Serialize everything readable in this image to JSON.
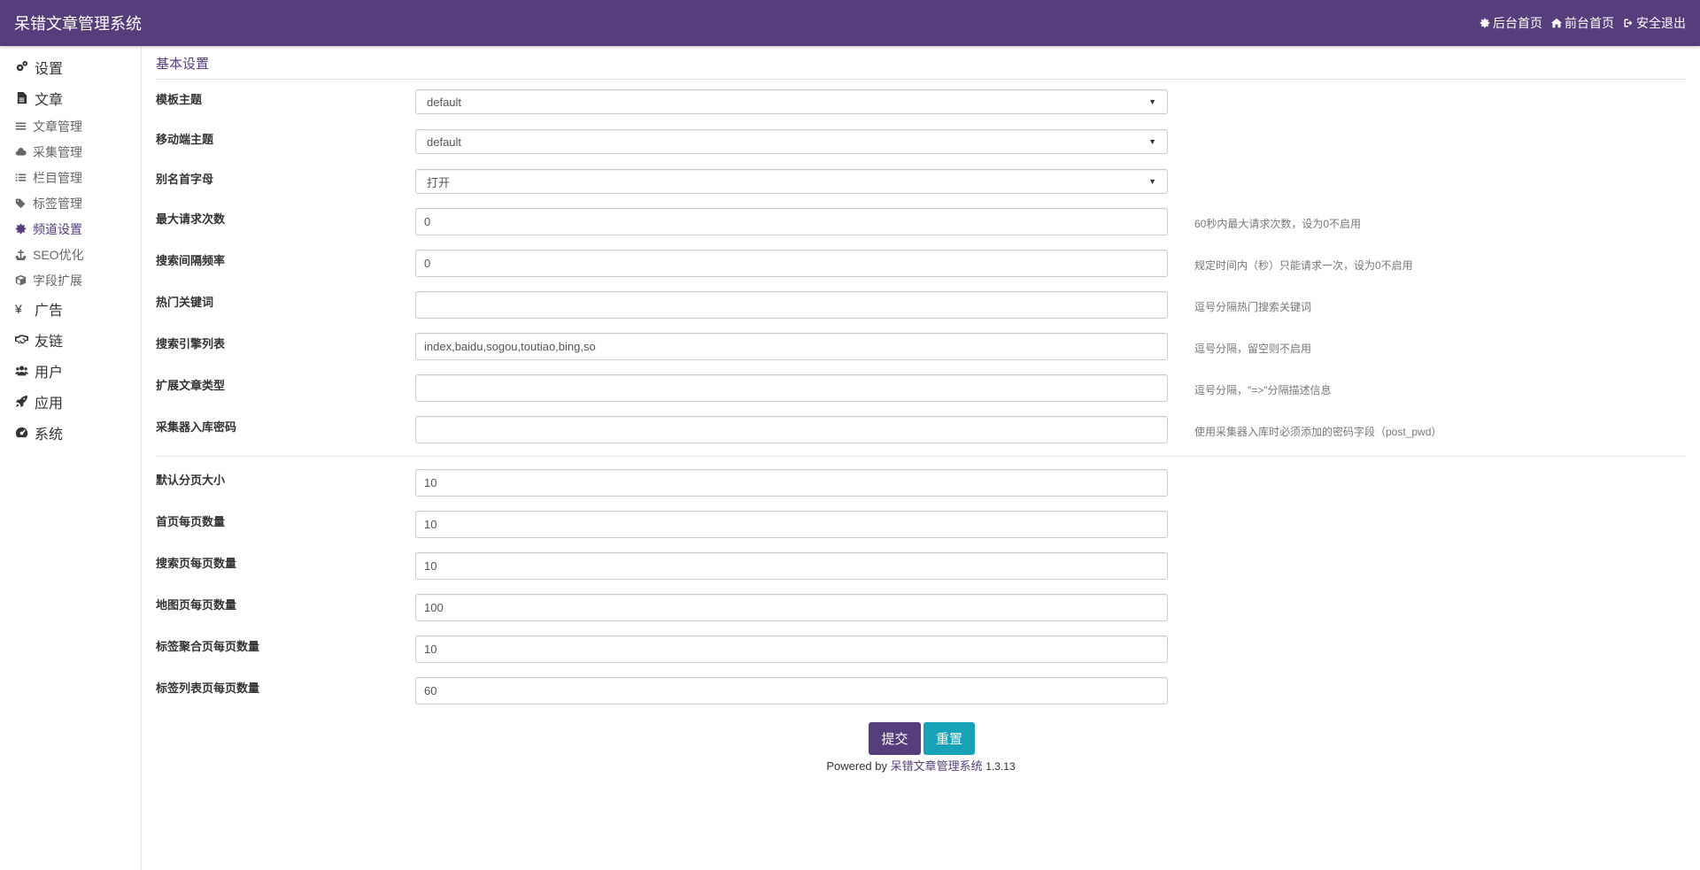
{
  "header": {
    "brand": "呆错文章管理系统",
    "nav": [
      {
        "label": "后台首页",
        "icon": "gear-icon"
      },
      {
        "label": "前台首页",
        "icon": "home-icon"
      },
      {
        "label": "安全退出",
        "icon": "sign-out-icon"
      }
    ]
  },
  "sidebar": {
    "items": [
      {
        "label": "设置",
        "icon": "cogs-icon",
        "type": "group"
      },
      {
        "label": "文章",
        "icon": "file-icon",
        "type": "group"
      },
      {
        "label": "文章管理",
        "icon": "list-icon",
        "type": "sub"
      },
      {
        "label": "采集管理",
        "icon": "cloud-icon",
        "type": "sub"
      },
      {
        "label": "栏目管理",
        "icon": "list-ul-icon",
        "type": "sub"
      },
      {
        "label": "标签管理",
        "icon": "tags-icon",
        "type": "sub"
      },
      {
        "label": "频道设置",
        "icon": "gear-icon",
        "type": "sub",
        "active": true
      },
      {
        "label": "SEO优化",
        "icon": "anchor-icon",
        "type": "sub"
      },
      {
        "label": "字段扩展",
        "icon": "cube-icon",
        "type": "sub"
      },
      {
        "label": "广告",
        "icon": "yen-icon",
        "type": "group"
      },
      {
        "label": "友链",
        "icon": "handshake-icon",
        "type": "group"
      },
      {
        "label": "用户",
        "icon": "users-icon",
        "type": "group"
      },
      {
        "label": "应用",
        "icon": "rocket-icon",
        "type": "group"
      },
      {
        "label": "系统",
        "icon": "dashboard-icon",
        "type": "group"
      }
    ]
  },
  "main": {
    "section_title": "基本设置",
    "fields": [
      {
        "label": "模板主题",
        "value": "default",
        "type": "select",
        "help": ""
      },
      {
        "label": "移动端主题",
        "value": "default",
        "type": "select",
        "help": ""
      },
      {
        "label": "别名首字母",
        "value": "打开",
        "type": "select",
        "help": ""
      },
      {
        "label": "最大请求次数",
        "value": "0",
        "type": "text",
        "help": "60秒内最大请求次数，设为0不启用"
      },
      {
        "label": "搜索间隔频率",
        "value": "0",
        "type": "text",
        "help": "规定时间内（秒）只能请求一次，设为0不启用"
      },
      {
        "label": "热门关键词",
        "value": "",
        "type": "text",
        "help": "逗号分隔热门搜索关键词"
      },
      {
        "label": "搜索引擎列表",
        "value": "index,baidu,sogou,toutiao,bing,so",
        "type": "text",
        "help": "逗号分隔，留空则不启用"
      },
      {
        "label": "扩展文章类型",
        "value": "",
        "type": "text",
        "help": "逗号分隔，\"=>\"分隔描述信息"
      },
      {
        "label": "采集器入库密码",
        "value": "",
        "type": "text",
        "help": "使用采集器入库时必须添加的密码字段（post_pwd）"
      }
    ],
    "fields2": [
      {
        "label": "默认分页大小",
        "value": "10"
      },
      {
        "label": "首页每页数量",
        "value": "10"
      },
      {
        "label": "搜索页每页数量",
        "value": "10"
      },
      {
        "label": "地图页每页数量",
        "value": "100"
      },
      {
        "label": "标签聚合页每页数量",
        "value": "10"
      },
      {
        "label": "标签列表页每页数量",
        "value": "60"
      }
    ],
    "submit_label": "提交",
    "reset_label": "重置"
  },
  "footer": {
    "powered_by": "Powered by",
    "product": "呆错文章管理系统",
    "version": "1.3.13"
  },
  "colors": {
    "brand": "#563d7c",
    "reset_button": "#17a2b8"
  }
}
